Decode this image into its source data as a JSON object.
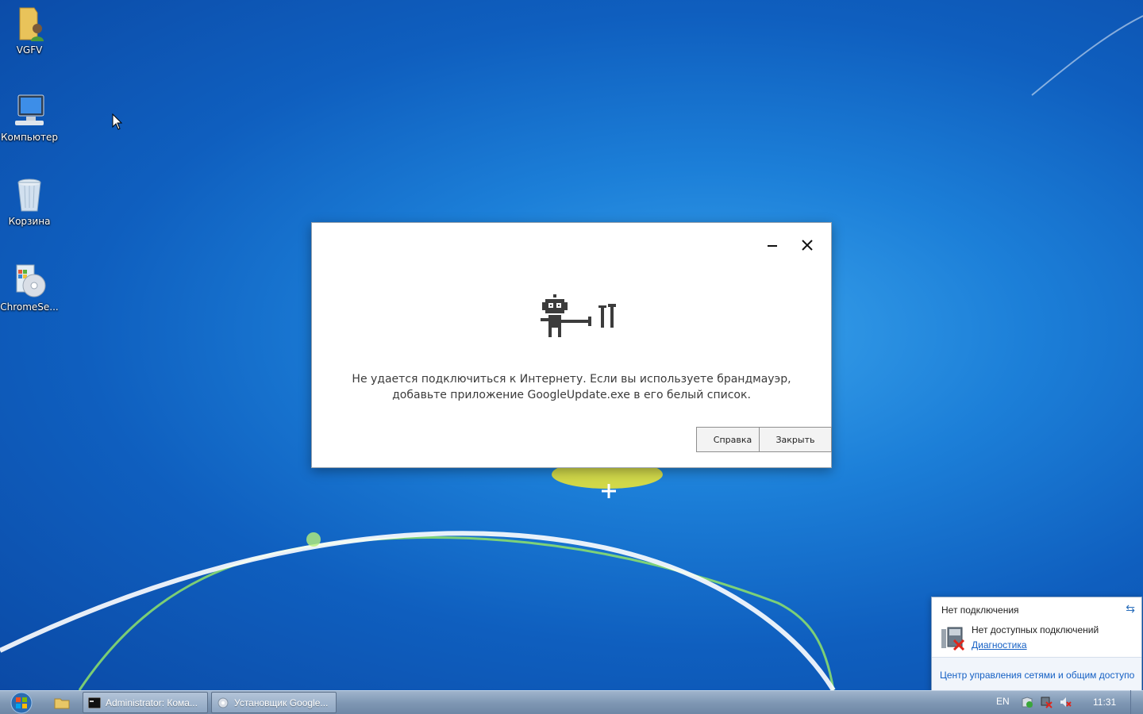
{
  "desktop": {
    "icons": [
      {
        "label": "VGFV",
        "icon": "user-folder-icon"
      },
      {
        "label": "Компьютер",
        "icon": "computer-icon"
      },
      {
        "label": "Корзина",
        "icon": "recycle-bin-icon"
      },
      {
        "label": "ChromeSe...",
        "icon": "installer-disc-icon"
      }
    ]
  },
  "dialog": {
    "message": "Не удается подключиться к Интернету. Если вы используете брандмауэр, добавьте приложение GoogleUpdate.exe в его белый список.",
    "help_button": "Справка",
    "close_button": "Закрыть",
    "illustration": "robot-with-tools-icon"
  },
  "notification": {
    "title": "Нет подключения",
    "body": "Нет доступных подключений",
    "link": "Диагностика",
    "footer_link": "Центр управления сетями и общим доступо"
  },
  "taskbar": {
    "buttons": [
      {
        "label": "Administrator: Кома...",
        "icon": "cmd-icon"
      },
      {
        "label": "Установщик Google...",
        "icon": "installer-icon"
      }
    ],
    "language": "EN",
    "time": "11:31"
  }
}
